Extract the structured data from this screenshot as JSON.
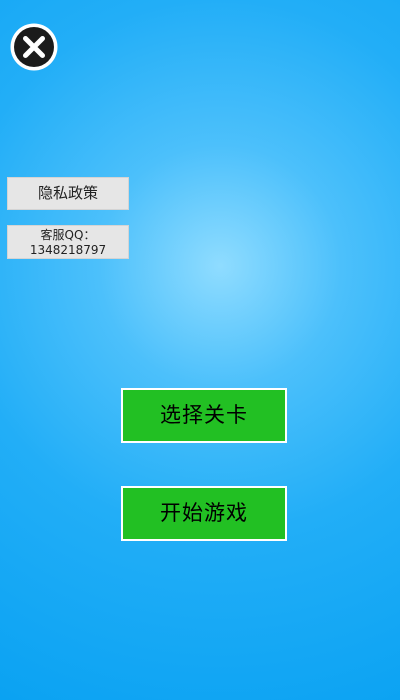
{
  "close_button": {
    "icon": "close-icon"
  },
  "sidebar": {
    "privacy_label": "隐私政策",
    "service_label": "客服QQ：",
    "service_qq": "1348218797"
  },
  "main": {
    "select_level_label": "选择关卡",
    "start_game_label": "开始游戏"
  },
  "colors": {
    "background": "#22aef7",
    "button_green": "#22c023",
    "side_button_bg": "#e6e6e6"
  }
}
